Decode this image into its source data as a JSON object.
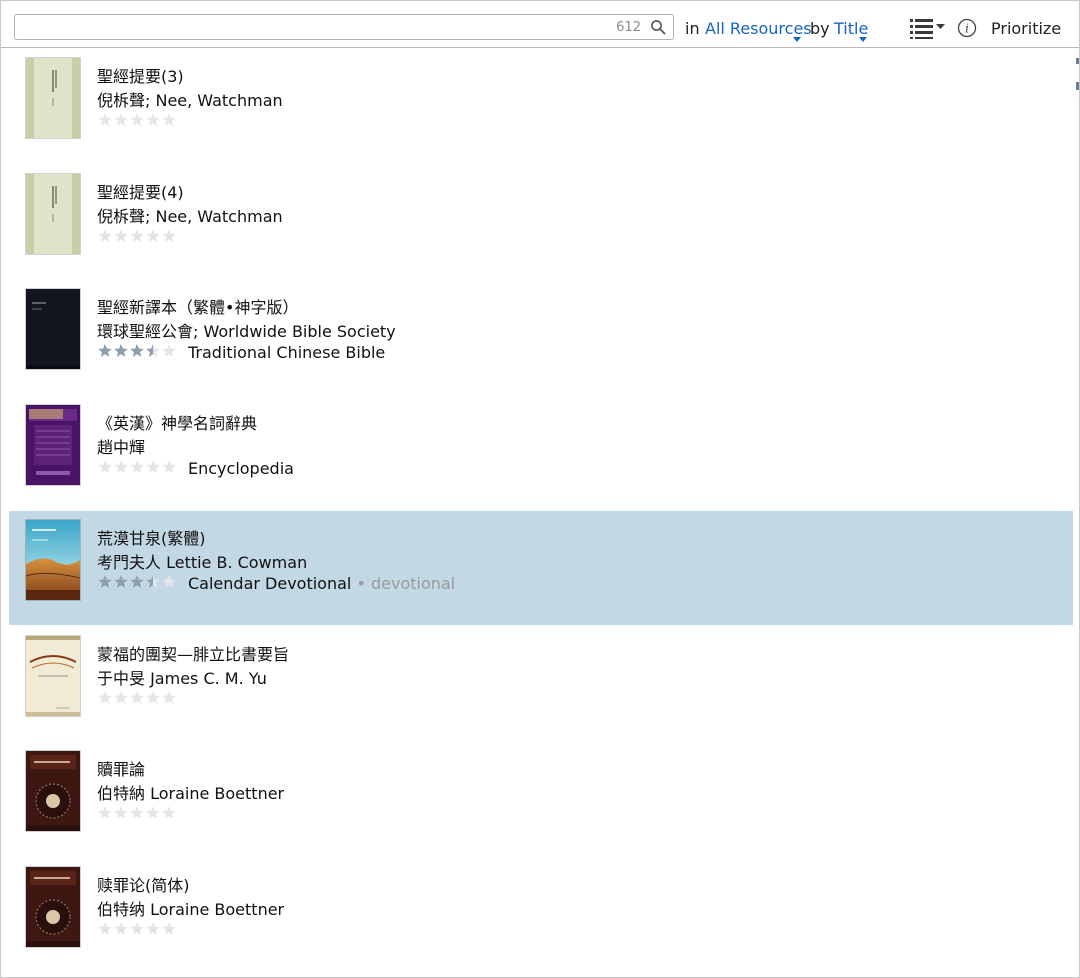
{
  "toolbar": {
    "search_value": "",
    "result_count": "612",
    "in_label": "in",
    "scope_link": "All Resources",
    "by_label": "by",
    "sort_link": "Title",
    "prioritize_label": "Prioritize",
    "accent_color": "#1565c0"
  },
  "resources": [
    {
      "title": "聖經提要(3)",
      "author": "倪柝聲; Nee, Watchman",
      "rating": 0,
      "type": "",
      "subtype": "",
      "cover": "green-light"
    },
    {
      "title": "聖經提要(4)",
      "author": "倪柝聲; Nee, Watchman",
      "rating": 0,
      "type": "",
      "subtype": "",
      "cover": "green-light"
    },
    {
      "title": "聖經新譯本（繁體•神字版）",
      "author": "環球聖經公會; Worldwide Bible Society",
      "rating": 3.5,
      "type": "Traditional Chinese Bible",
      "subtype": "",
      "cover": "dark-navy"
    },
    {
      "title": "《英漢》神學名詞辭典",
      "author": "趙中輝",
      "rating": 0,
      "type": "Encyclopedia",
      "subtype": "",
      "cover": "purple"
    },
    {
      "title": "荒漠甘泉(繁體)",
      "author": "考門夫人 Lettie B. Cowman",
      "rating": 3.5,
      "type": "Calendar Devotional",
      "subtype": " • devotional",
      "cover": "desert",
      "selected": true
    },
    {
      "title": "蒙福的團契—腓立比書要旨",
      "author": "于中旻 James C. M. Yu",
      "rating": 0,
      "type": "",
      "subtype": "",
      "cover": "cream"
    },
    {
      "title": "贖罪論",
      "author": "伯特納 Loraine Boettner",
      "rating": 0,
      "type": "",
      "subtype": "",
      "cover": "maroon"
    },
    {
      "title": "赎罪论(简体)",
      "author": "伯特纳 Loraine Boettner",
      "rating": 0,
      "type": "",
      "subtype": "",
      "cover": "maroon"
    }
  ],
  "colors": {
    "selected_row": "#c3d8e5",
    "rated_star": "#8e9eae",
    "empty_star": "#e3e6e9",
    "subtype_text": "#9b9b9b"
  }
}
